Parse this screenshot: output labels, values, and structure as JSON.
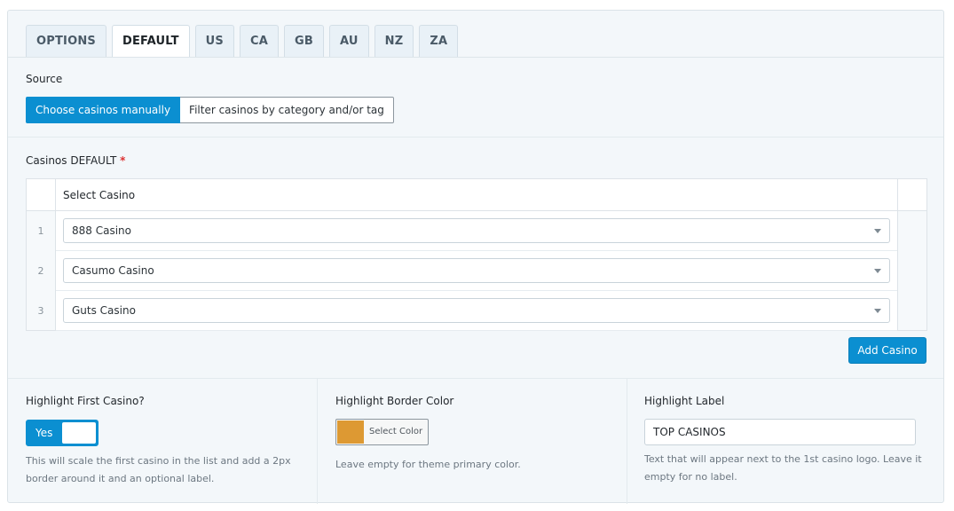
{
  "tabs": [
    {
      "label": "OPTIONS",
      "active": false
    },
    {
      "label": "DEFAULT",
      "active": true
    },
    {
      "label": "US",
      "active": false
    },
    {
      "label": "CA",
      "active": false
    },
    {
      "label": "GB",
      "active": false
    },
    {
      "label": "AU",
      "active": false
    },
    {
      "label": "NZ",
      "active": false
    },
    {
      "label": "ZA",
      "active": false
    }
  ],
  "source": {
    "label": "Source",
    "options": [
      "Choose casinos manually",
      "Filter casinos by category and/or tag"
    ],
    "selected": "Choose casinos manually"
  },
  "casinos": {
    "label": "Casinos DEFAULT",
    "required_mark": "*",
    "column_header": "Select Casino",
    "rows": [
      {
        "index": "1",
        "value": "888 Casino"
      },
      {
        "index": "2",
        "value": "Casumo Casino"
      },
      {
        "index": "3",
        "value": "Guts Casino"
      }
    ],
    "add_label": "Add Casino"
  },
  "highlight_first": {
    "label": "Highlight First Casino?",
    "toggle_label": "Yes",
    "help": "This will scale the first casino in the list and add a 2px border around it and an optional label."
  },
  "highlight_border": {
    "label": "Highlight Border Color",
    "button_label": "Select Color",
    "swatch_color": "#dd9933",
    "help": "Leave empty for theme primary color."
  },
  "highlight_label": {
    "label": "Highlight Label",
    "value": "TOP CASINOS",
    "help": "Text that will appear next to the 1st casino logo. Leave it empty for no label."
  },
  "colors": {
    "accent": "#0b8fd1",
    "panel_bg": "#f3f7fa"
  }
}
